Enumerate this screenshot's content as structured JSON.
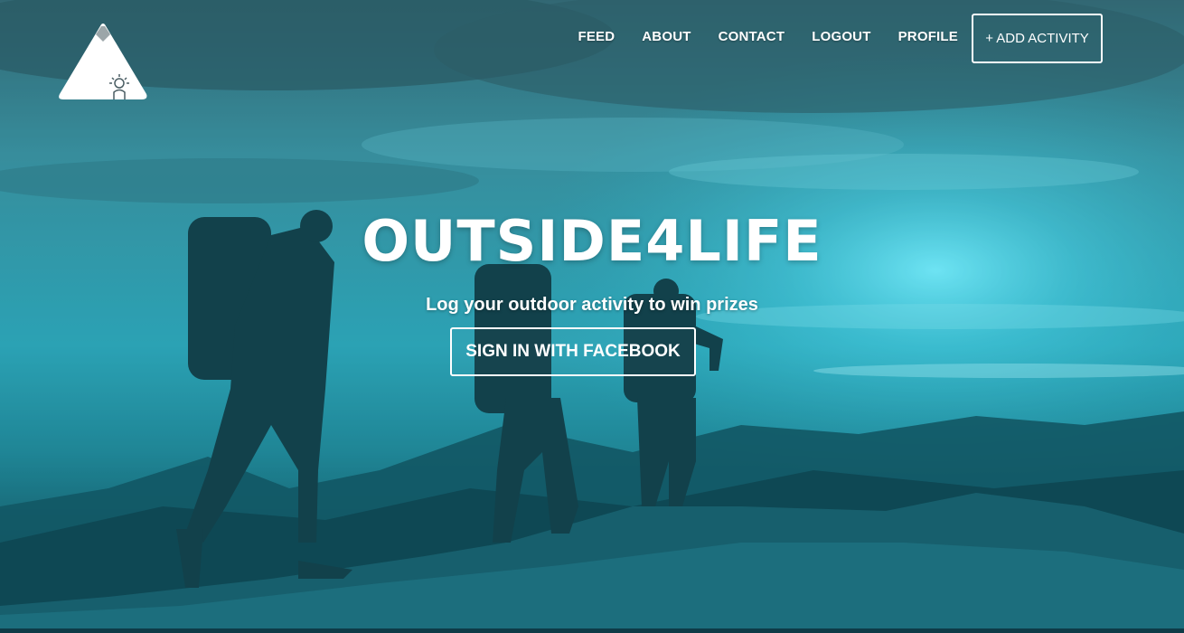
{
  "brand": {
    "logo_icon": "mountain-sun-logo-icon"
  },
  "nav": {
    "items": [
      {
        "label": "FEED"
      },
      {
        "label": "ABOUT"
      },
      {
        "label": "CONTACT"
      },
      {
        "label": "LOGOUT"
      },
      {
        "label": "PROFILE"
      }
    ],
    "add_activity_label": "+ ADD ACTIVITY"
  },
  "hero": {
    "title": "OUTSIDE4LIFE",
    "subtitle": "Log your outdoor activity to win prizes",
    "cta_label": "SIGN IN WITH FACEBOOK",
    "image": "hikers-on-mountain-ridge-photo",
    "tint_color": "#2fc3d6"
  }
}
